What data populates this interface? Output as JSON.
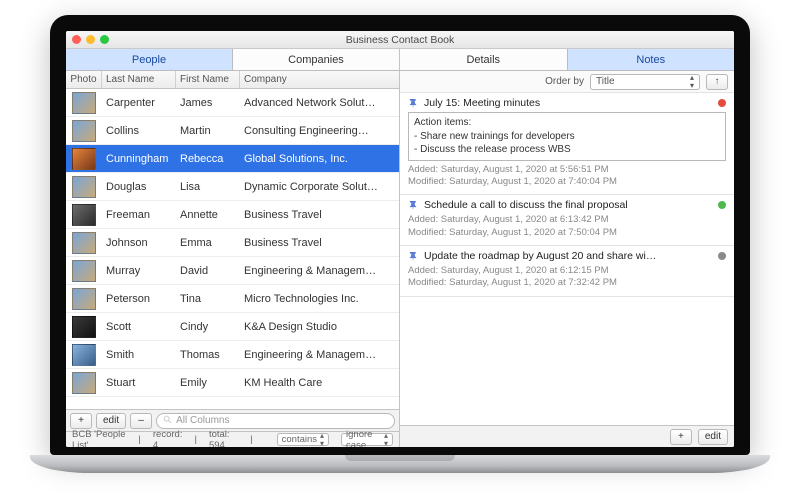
{
  "window": {
    "title": "Business Contact Book"
  },
  "leftTabs": {
    "people": "People",
    "companies": "Companies"
  },
  "rightTabs": {
    "details": "Details",
    "notes": "Notes"
  },
  "columns": {
    "photo": "Photo",
    "last": "Last Name",
    "first": "First Name",
    "company": "Company"
  },
  "rows": [
    {
      "last": "Carpenter",
      "first": "James",
      "company": "Advanced Network Solut…"
    },
    {
      "last": "Collins",
      "first": "Martin",
      "company": "Consulting Engineering…"
    },
    {
      "last": "Cunningham",
      "first": "Rebecca",
      "company": "Global Solutions, Inc."
    },
    {
      "last": "Douglas",
      "first": "Lisa",
      "company": "Dynamic Corporate Solut…"
    },
    {
      "last": "Freeman",
      "first": "Annette",
      "company": "Business Travel"
    },
    {
      "last": "Johnson",
      "first": "Emma",
      "company": "Business Travel"
    },
    {
      "last": "Murray",
      "first": "David",
      "company": "Engineering & Managem…"
    },
    {
      "last": "Peterson",
      "first": "Tina",
      "company": "Micro Technologies Inc."
    },
    {
      "last": "Scott",
      "first": "Cindy",
      "company": "K&A Design Studio"
    },
    {
      "last": "Smith",
      "first": "Thomas",
      "company": "Engineering & Managem…"
    },
    {
      "last": "Stuart",
      "first": "Emily",
      "company": "KM Health Care"
    }
  ],
  "leftFooter": {
    "add": "+",
    "edit": "edit",
    "remove": "–",
    "searchPlaceholder": "All Columns"
  },
  "status": {
    "name": "BCB 'People List'",
    "record": "record: 4",
    "total": "total: 594",
    "contains": "contains",
    "ignore": "ignore case"
  },
  "orderbar": {
    "label": "Order by",
    "value": "Title",
    "up": "↑"
  },
  "notes": [
    {
      "title": "July 15: Meeting minutes",
      "dot": "red",
      "body": "Action items:\n- Share new trainings for developers\n- Discuss the release process WBS",
      "added": "Added: Saturday, August 1, 2020 at 5:56:51 PM",
      "modified": "Modified: Saturday, August 1, 2020 at 7:40:04 PM"
    },
    {
      "title": "Schedule a call to discuss the final proposal",
      "dot": "green",
      "body": null,
      "added": "Added: Saturday, August 1, 2020 at 6:13:42 PM",
      "modified": "Modified: Saturday, August 1, 2020 at 7:50:04 PM"
    },
    {
      "title": "Update the roadmap by August 20 and share wi…",
      "dot": "gray",
      "body": null,
      "added": "Added: Saturday, August 1, 2020 at 6:12:15 PM",
      "modified": "Modified: Saturday, August 1, 2020 at 7:32:42 PM"
    }
  ],
  "rightFooter": {
    "add": "+",
    "edit": "edit"
  }
}
